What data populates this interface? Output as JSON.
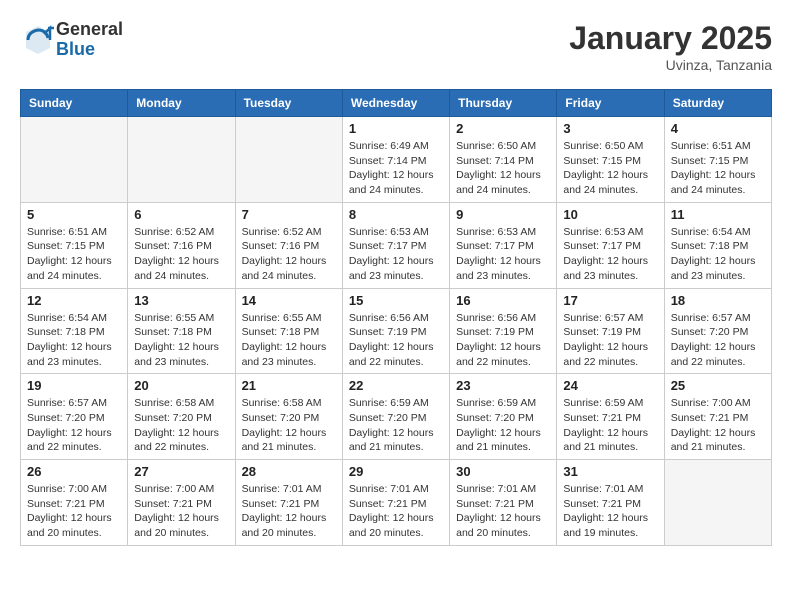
{
  "header": {
    "logo_general": "General",
    "logo_blue": "Blue",
    "month": "January 2025",
    "location": "Uvinza, Tanzania"
  },
  "days_of_week": [
    "Sunday",
    "Monday",
    "Tuesday",
    "Wednesday",
    "Thursday",
    "Friday",
    "Saturday"
  ],
  "weeks": [
    [
      {
        "day": "",
        "info": ""
      },
      {
        "day": "",
        "info": ""
      },
      {
        "day": "",
        "info": ""
      },
      {
        "day": "1",
        "info": "Sunrise: 6:49 AM\nSunset: 7:14 PM\nDaylight: 12 hours\nand 24 minutes."
      },
      {
        "day": "2",
        "info": "Sunrise: 6:50 AM\nSunset: 7:14 PM\nDaylight: 12 hours\nand 24 minutes."
      },
      {
        "day": "3",
        "info": "Sunrise: 6:50 AM\nSunset: 7:15 PM\nDaylight: 12 hours\nand 24 minutes."
      },
      {
        "day": "4",
        "info": "Sunrise: 6:51 AM\nSunset: 7:15 PM\nDaylight: 12 hours\nand 24 minutes."
      }
    ],
    [
      {
        "day": "5",
        "info": "Sunrise: 6:51 AM\nSunset: 7:15 PM\nDaylight: 12 hours\nand 24 minutes."
      },
      {
        "day": "6",
        "info": "Sunrise: 6:52 AM\nSunset: 7:16 PM\nDaylight: 12 hours\nand 24 minutes."
      },
      {
        "day": "7",
        "info": "Sunrise: 6:52 AM\nSunset: 7:16 PM\nDaylight: 12 hours\nand 24 minutes."
      },
      {
        "day": "8",
        "info": "Sunrise: 6:53 AM\nSunset: 7:17 PM\nDaylight: 12 hours\nand 23 minutes."
      },
      {
        "day": "9",
        "info": "Sunrise: 6:53 AM\nSunset: 7:17 PM\nDaylight: 12 hours\nand 23 minutes."
      },
      {
        "day": "10",
        "info": "Sunrise: 6:53 AM\nSunset: 7:17 PM\nDaylight: 12 hours\nand 23 minutes."
      },
      {
        "day": "11",
        "info": "Sunrise: 6:54 AM\nSunset: 7:18 PM\nDaylight: 12 hours\nand 23 minutes."
      }
    ],
    [
      {
        "day": "12",
        "info": "Sunrise: 6:54 AM\nSunset: 7:18 PM\nDaylight: 12 hours\nand 23 minutes."
      },
      {
        "day": "13",
        "info": "Sunrise: 6:55 AM\nSunset: 7:18 PM\nDaylight: 12 hours\nand 23 minutes."
      },
      {
        "day": "14",
        "info": "Sunrise: 6:55 AM\nSunset: 7:18 PM\nDaylight: 12 hours\nand 23 minutes."
      },
      {
        "day": "15",
        "info": "Sunrise: 6:56 AM\nSunset: 7:19 PM\nDaylight: 12 hours\nand 22 minutes."
      },
      {
        "day": "16",
        "info": "Sunrise: 6:56 AM\nSunset: 7:19 PM\nDaylight: 12 hours\nand 22 minutes."
      },
      {
        "day": "17",
        "info": "Sunrise: 6:57 AM\nSunset: 7:19 PM\nDaylight: 12 hours\nand 22 minutes."
      },
      {
        "day": "18",
        "info": "Sunrise: 6:57 AM\nSunset: 7:20 PM\nDaylight: 12 hours\nand 22 minutes."
      }
    ],
    [
      {
        "day": "19",
        "info": "Sunrise: 6:57 AM\nSunset: 7:20 PM\nDaylight: 12 hours\nand 22 minutes."
      },
      {
        "day": "20",
        "info": "Sunrise: 6:58 AM\nSunset: 7:20 PM\nDaylight: 12 hours\nand 22 minutes."
      },
      {
        "day": "21",
        "info": "Sunrise: 6:58 AM\nSunset: 7:20 PM\nDaylight: 12 hours\nand 21 minutes."
      },
      {
        "day": "22",
        "info": "Sunrise: 6:59 AM\nSunset: 7:20 PM\nDaylight: 12 hours\nand 21 minutes."
      },
      {
        "day": "23",
        "info": "Sunrise: 6:59 AM\nSunset: 7:20 PM\nDaylight: 12 hours\nand 21 minutes."
      },
      {
        "day": "24",
        "info": "Sunrise: 6:59 AM\nSunset: 7:21 PM\nDaylight: 12 hours\nand 21 minutes."
      },
      {
        "day": "25",
        "info": "Sunrise: 7:00 AM\nSunset: 7:21 PM\nDaylight: 12 hours\nand 21 minutes."
      }
    ],
    [
      {
        "day": "26",
        "info": "Sunrise: 7:00 AM\nSunset: 7:21 PM\nDaylight: 12 hours\nand 20 minutes."
      },
      {
        "day": "27",
        "info": "Sunrise: 7:00 AM\nSunset: 7:21 PM\nDaylight: 12 hours\nand 20 minutes."
      },
      {
        "day": "28",
        "info": "Sunrise: 7:01 AM\nSunset: 7:21 PM\nDaylight: 12 hours\nand 20 minutes."
      },
      {
        "day": "29",
        "info": "Sunrise: 7:01 AM\nSunset: 7:21 PM\nDaylight: 12 hours\nand 20 minutes."
      },
      {
        "day": "30",
        "info": "Sunrise: 7:01 AM\nSunset: 7:21 PM\nDaylight: 12 hours\nand 20 minutes."
      },
      {
        "day": "31",
        "info": "Sunrise: 7:01 AM\nSunset: 7:21 PM\nDaylight: 12 hours\nand 19 minutes."
      },
      {
        "day": "",
        "info": ""
      }
    ]
  ]
}
